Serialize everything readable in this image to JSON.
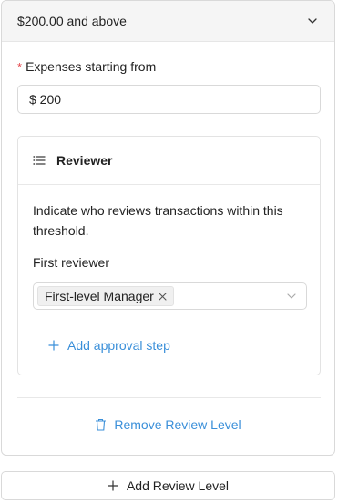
{
  "level": {
    "title": "$200.00 and above",
    "expenses_label": "Expenses starting from",
    "required_mark": "*",
    "amount_value": "$ 200",
    "reviewer": {
      "title": "Reviewer",
      "description": "Indicate who reviews transactions within this threshold.",
      "first_reviewer_label": "First reviewer",
      "selected_tag": "First-level Manager",
      "add_step_label": "Add approval step"
    },
    "remove_label": "Remove Review Level"
  },
  "add_level_label": "Add Review Level",
  "icons": {
    "header_toggle": "chevron-down-icon",
    "reviewer_list": "list-icon",
    "tag_remove": "close-icon",
    "select_arrow": "chevron-down-icon",
    "add_step": "plus-icon",
    "remove_level": "trash-icon",
    "add_level": "plus-icon"
  },
  "colors": {
    "accent": "#3a8fd9",
    "required": "#e5484d",
    "header_bg": "#f5f5f5",
    "border": "#d9d9d9"
  }
}
